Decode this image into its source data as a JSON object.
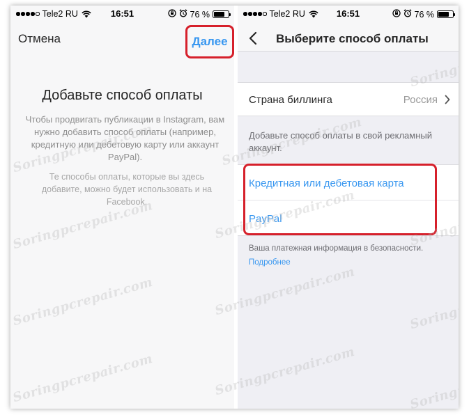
{
  "status_bar": {
    "carrier": "Tele2 RU",
    "time": "16:51",
    "battery": "76 %",
    "battery_level": 0.76,
    "icons": [
      "signal-dots",
      "wifi-icon",
      "orientation-lock-icon",
      "alarm-icon",
      "battery-icon"
    ]
  },
  "left_screen": {
    "cancel_label": "Отмена",
    "next_label": "Далее",
    "heading": "Добавьте способ оплаты",
    "description": "Чтобы продвигать публикации в Instagram, вам нужно добавить способ оплаты (например, кредитную или дебетовую карту или аккаунт PayPal).",
    "note": "Те способы оплаты, которые вы здесь добавите, можно будет использовать и на Facebook."
  },
  "right_screen": {
    "title": "Выберите способ оплаты",
    "billing_country_label": "Страна биллинга",
    "billing_country_value": "Россия",
    "section_text": "Добавьте способ оплаты в свой рекламный аккаунт.",
    "methods": [
      {
        "label": "Кредитная или дебетовая карта"
      },
      {
        "label": "PayPal"
      }
    ],
    "security_text": "Ваша платежная информация в безопасности.",
    "more_label": "Подробнее"
  },
  "watermark": "Soringpcrepair.com",
  "colors": {
    "accent": "#3897f0",
    "highlight": "#d6202b",
    "text": "#262626",
    "muted": "#8e8e8e",
    "grouped_bg": "#efeff4"
  }
}
